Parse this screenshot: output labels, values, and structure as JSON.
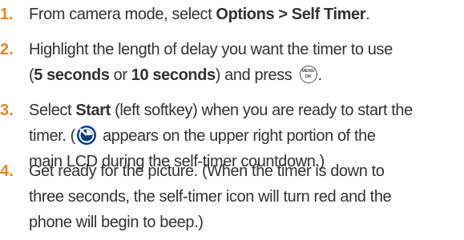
{
  "steps": [
    {
      "number": "1.",
      "parts": {
        "a": "From camera mode, select ",
        "b": "Options > Self Timer",
        "c": "."
      }
    },
    {
      "number": "2.",
      "parts": {
        "l1": "Highlight the length of delay you want the timer to use",
        "l2a": "(",
        "l2b": "5 seconds",
        "l2c": " or ",
        "l2d": "10 seconds",
        "l2e": ") and press ",
        "l2f": "."
      },
      "icon": {
        "name": "menu-ok-key-icon",
        "top": "MENU",
        "bottom": "OK"
      }
    },
    {
      "number": "3.",
      "parts": {
        "l1a": "Select ",
        "l1b": "Start",
        "l1c": " (left softkey) when you are ready to start the",
        "l2a": "timer. (",
        "l2b": " appears on the upper right portion of the",
        "l3": "main LCD during the self-timer countdown.)"
      },
      "icon": {
        "name": "self-timer-icon",
        "color": "#0a3a8c"
      }
    },
    {
      "number": "4.",
      "parts": {
        "l1": "Get ready for the picture. (When the timer is down to",
        "l2": "three seconds, the self-timer icon will turn red and the",
        "l3": "phone will begin to beep.)"
      }
    }
  ],
  "colors": {
    "step_number": "#e4891f",
    "text": "#333333"
  }
}
